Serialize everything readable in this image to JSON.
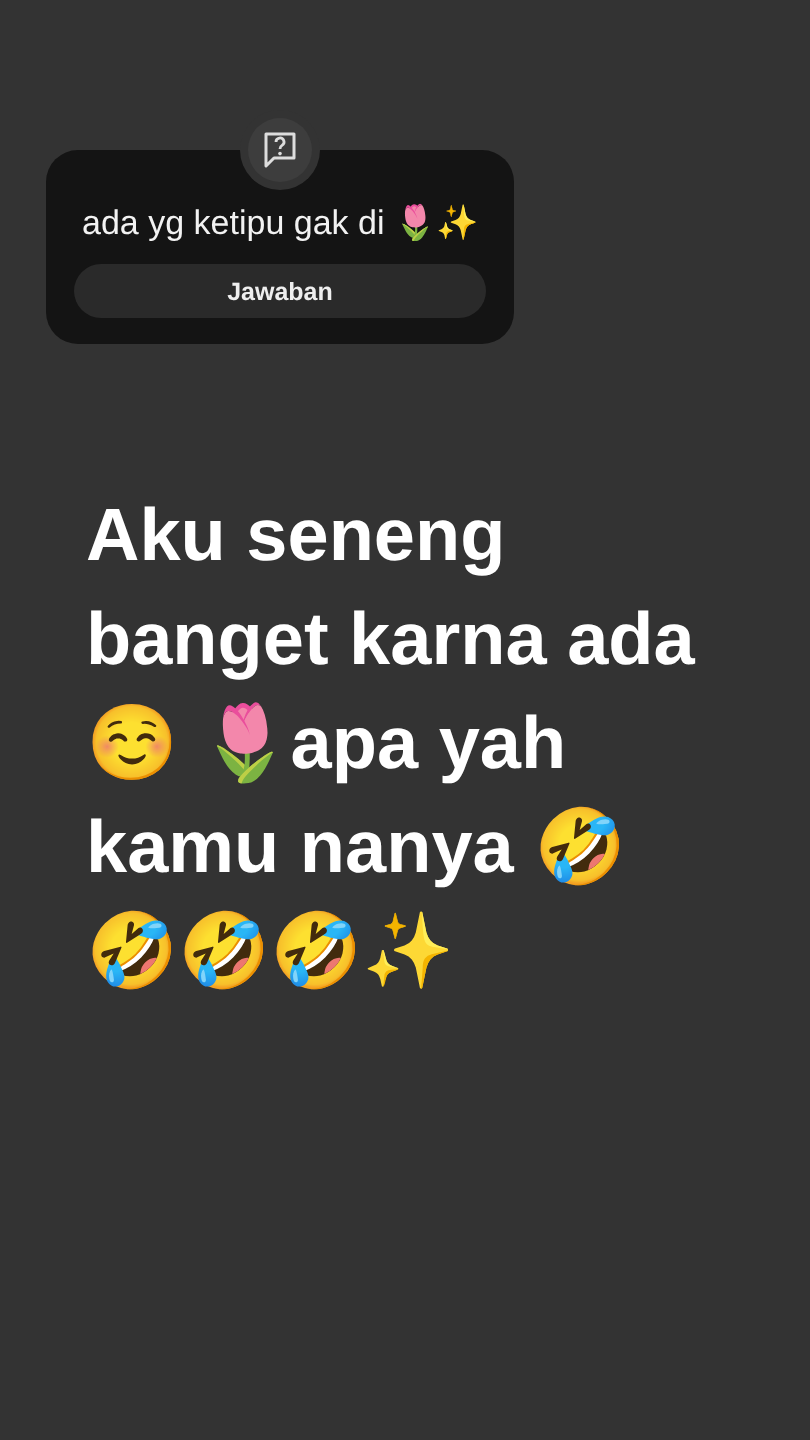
{
  "question_sticker": {
    "question": "ada yg ketipu gak di 🌷✨",
    "button": "Jawaban"
  },
  "caption": {
    "lines": [
      "Aku seneng",
      "banget karna ada",
      "☺️ 🌷apa yah",
      "kamu nanya 🤣",
      "🤣🤣🤣✨"
    ]
  }
}
